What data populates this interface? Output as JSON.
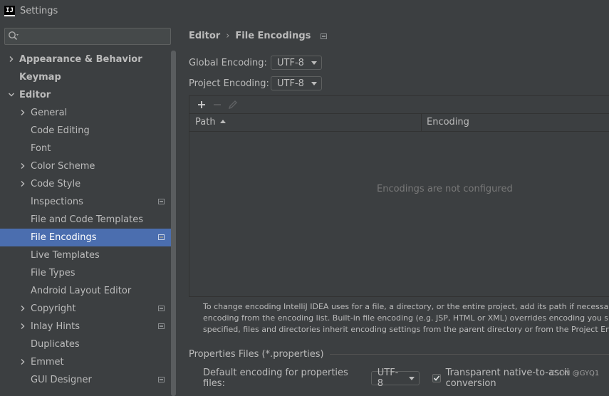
{
  "window": {
    "title": "Settings",
    "app_icon_text": "IJ"
  },
  "sidebar": {
    "search": {
      "value": "",
      "placeholder": ""
    },
    "items": [
      {
        "label": "Appearance & Behavior",
        "level": 0,
        "bold": true,
        "expandable": true,
        "expanded": false,
        "badge": false
      },
      {
        "label": "Keymap",
        "level": 0,
        "bold": true,
        "expandable": false,
        "badge": false
      },
      {
        "label": "Editor",
        "level": 0,
        "bold": true,
        "expandable": true,
        "expanded": true,
        "badge": false
      },
      {
        "label": "General",
        "level": 1,
        "expandable": true,
        "expanded": false,
        "badge": false
      },
      {
        "label": "Code Editing",
        "level": 1,
        "expandable": false,
        "badge": false
      },
      {
        "label": "Font",
        "level": 1,
        "expandable": false,
        "badge": false
      },
      {
        "label": "Color Scheme",
        "level": 1,
        "expandable": true,
        "expanded": false,
        "badge": false
      },
      {
        "label": "Code Style",
        "level": 1,
        "expandable": true,
        "expanded": false,
        "badge": false
      },
      {
        "label": "Inspections",
        "level": 1,
        "expandable": false,
        "badge": true
      },
      {
        "label": "File and Code Templates",
        "level": 1,
        "expandable": false,
        "badge": false
      },
      {
        "label": "File Encodings",
        "level": 1,
        "expandable": false,
        "badge": true,
        "selected": true
      },
      {
        "label": "Live Templates",
        "level": 1,
        "expandable": false,
        "badge": false
      },
      {
        "label": "File Types",
        "level": 1,
        "expandable": false,
        "badge": false
      },
      {
        "label": "Android Layout Editor",
        "level": 1,
        "expandable": false,
        "badge": false
      },
      {
        "label": "Copyright",
        "level": 1,
        "expandable": true,
        "expanded": false,
        "badge": true
      },
      {
        "label": "Inlay Hints",
        "level": 1,
        "expandable": true,
        "expanded": false,
        "badge": true
      },
      {
        "label": "Duplicates",
        "level": 1,
        "expandable": false,
        "badge": false
      },
      {
        "label": "Emmet",
        "level": 1,
        "expandable": true,
        "expanded": false,
        "badge": false
      },
      {
        "label": "GUI Designer",
        "level": 1,
        "expandable": false,
        "badge": true
      }
    ]
  },
  "main": {
    "breadcrumb": {
      "parent": "Editor",
      "separator": "›",
      "current": "File Encodings"
    },
    "global_encoding": {
      "label": "Global Encoding:",
      "value": "UTF-8"
    },
    "project_encoding": {
      "label": "Project Encoding:",
      "value": "UTF-8"
    },
    "table": {
      "columns": [
        "Path",
        "Encoding"
      ],
      "sort_column": "Path",
      "empty_text": "Encodings are not configured",
      "toolbar": {
        "add": "+",
        "remove": "−"
      }
    },
    "help_lines": [
      "To change encoding IntelliJ IDEA uses for a file, a directory, or the entire project, add its path if necessary and",
      "encoding from the encoding list. Built-in file encoding (e.g. JSP, HTML or XML) overrides encoding you spec",
      "specified, files and directories inherit encoding settings from the parent directory or from the Project Encodin"
    ],
    "properties": {
      "section_title": "Properties Files (*.properties)",
      "default_label": "Default encoding for properties files:",
      "default_value": "UTF-8",
      "transparent_label": "Transparent native-to-ascii conversion",
      "transparent_checked": true
    },
    "watermark": "CSDN @GYQ1"
  },
  "colors": {
    "background": "#3c3f41",
    "selection": "#4b6eaf",
    "text": "#bbbbbb",
    "muted": "#787878"
  }
}
